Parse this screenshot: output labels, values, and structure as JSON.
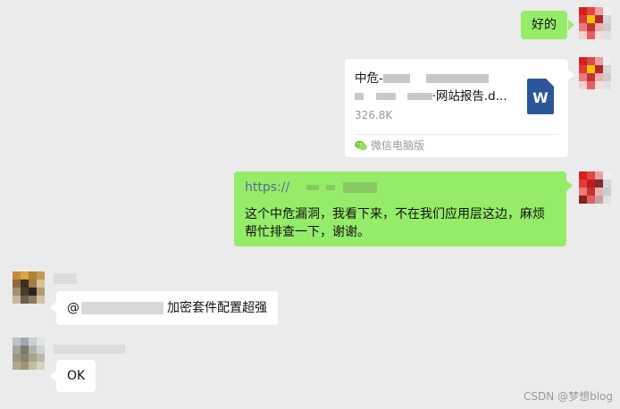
{
  "messages": [
    {
      "text": "好的"
    },
    {
      "file": {
        "name_prefix": "中危-",
        "name_suffix": "·网站报告.d...",
        "size": "326.8K",
        "source": "微信电脑版",
        "icon_letter": "W"
      }
    },
    {
      "link": "https://",
      "text": "这个中危漏洞，我看下来，不在我们应用层这边，麻烦帮忙排查一下，谢谢。"
    },
    {
      "mention": "@",
      "text": "加密套件配置超强"
    },
    {
      "text": "OK"
    }
  ],
  "watermark": "CSDN @梦想blog",
  "colors": {
    "sent_bubble": "#95ec69",
    "received_bubble": "#ffffff",
    "background": "#ebebeb",
    "word_blue": "#2b579a"
  }
}
